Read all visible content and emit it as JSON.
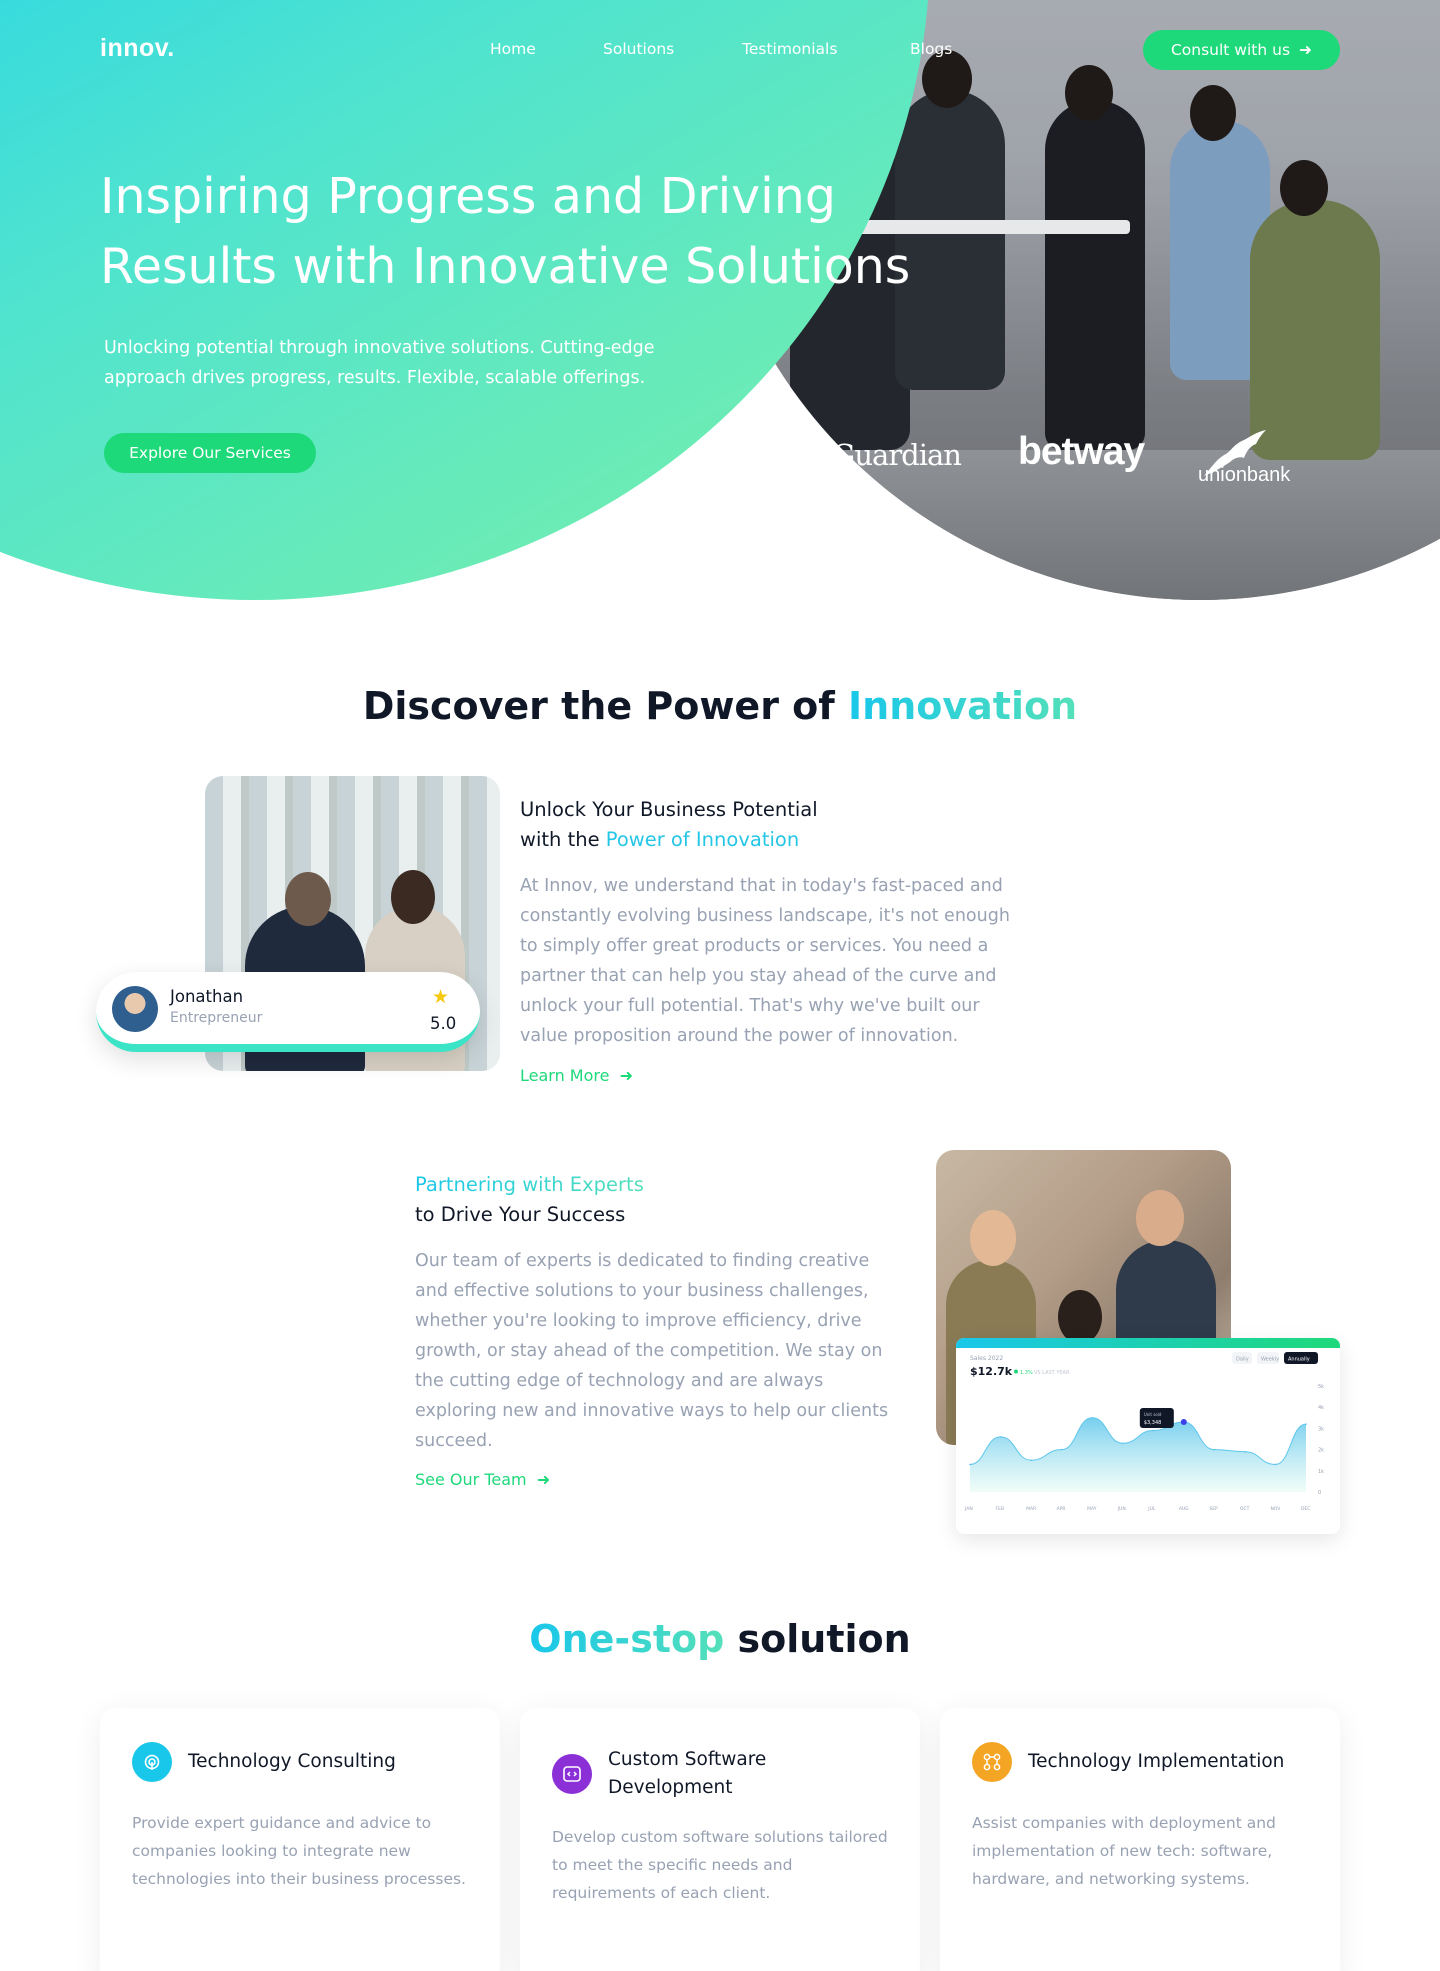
{
  "nav": {
    "logo": "innov.",
    "links": [
      "Home",
      "Solutions",
      "Testimonials",
      "Blogs"
    ],
    "cta": "Consult with us"
  },
  "hero": {
    "title": "Inspiring Progress and Driving Results with Innovative Solutions",
    "subtitle": "Unlocking potential through innovative solutions. Cutting-edge approach drives progress, results. Flexible, scalable offerings.",
    "cta": "Explore Our Services",
    "brands": [
      "TheGuardian",
      "betway",
      "unionbank"
    ]
  },
  "discover": {
    "title_part1": "Discover the Power of ",
    "title_accent": "Innovation",
    "block1": {
      "heading_line1": "Unlock Your Business Potential",
      "heading_line2_prefix": "with the ",
      "heading_line2_accent": "Power of Innovation",
      "body": "At Innov, we understand that in today's fast-paced and constantly evolving business landscape, it's not enough to simply offer great products or services. You need a partner that can help you stay ahead of the curve and unlock your full potential. That's why we've built our value proposition around the power of innovation.",
      "link": "Learn More",
      "review": {
        "name": "Jonathan",
        "role": "Entrepreneur",
        "score": "5.0"
      }
    },
    "block2": {
      "heading_accent": "Partnering with Experts",
      "heading_line2": "to Drive Your Success",
      "body": "Our team of experts is dedicated to finding creative and effective solutions to your business challenges, whether you're looking to improve efficiency, drive growth, or stay ahead of the competition. We stay on the cutting edge of technology and are always exploring new and innovative ways to help our clients succeed.",
      "link": "See Our Team"
    }
  },
  "chart_data": {
    "type": "area",
    "title": "Sales 2022",
    "headline": "$12.7k",
    "change": "1.3%",
    "change_label": "VS LAST YEAR",
    "tabs": [
      "Daily",
      "Weekly",
      "Annually"
    ],
    "active_tab": "Annually",
    "categories": [
      "JAN",
      "FEB",
      "MAR",
      "APR",
      "MAY",
      "JUN",
      "JUL",
      "AUG",
      "SEP",
      "OCT",
      "NOV",
      "DEC"
    ],
    "y_ticks": [
      "0",
      "1k",
      "2k",
      "3k",
      "4k",
      "5k"
    ],
    "ylim": [
      0,
      5000
    ],
    "values": [
      1300,
      2600,
      1500,
      2000,
      3500,
      2300,
      2900,
      3300,
      2000,
      1900,
      1300,
      3200
    ],
    "tooltip": {
      "label": "Unit sold",
      "value": "$3,348"
    },
    "series_color": "#5ec6ec"
  },
  "one_stop": {
    "title_accent": "One-stop",
    "title_rest": " solution",
    "services": [
      {
        "icon": "fingerprint-icon",
        "color": "#19c7ea",
        "title": "Technology Consulting",
        "desc": "Provide expert guidance and advice to companies looking to integrate new technologies into their business processes."
      },
      {
        "icon": "code-window-icon",
        "color": "#8b2fd6",
        "title": "Custom Software Development",
        "desc": "Develop custom software solutions tailored to meet the specific needs and requirements of each client."
      },
      {
        "icon": "network-nodes-icon",
        "color": "#f5a524",
        "title": "Technology Implementation",
        "desc": "Assist companies with deployment and implementation of new tech: software, hardware, and networking systems."
      }
    ]
  }
}
